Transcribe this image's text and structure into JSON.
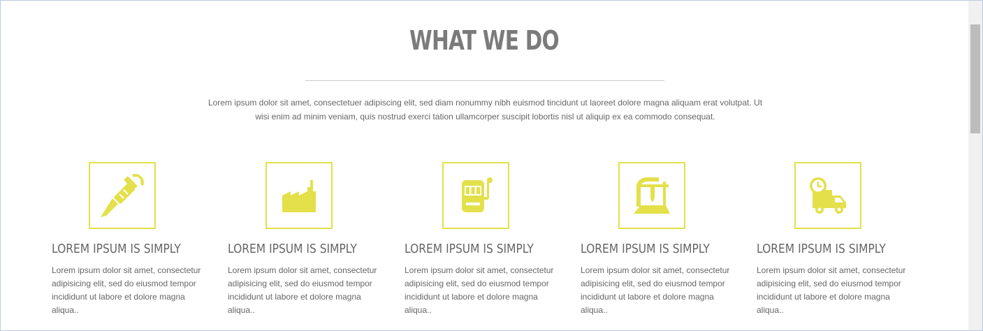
{
  "section": {
    "title": "WHAT WE DO",
    "intro": "Lorem ipsum dolor sit amet, consectetuer adipiscing elit, sed diam nonummy nibh euismod tincidunt ut laoreet dolore magna aliquam erat volutpat. Ut wisi enim ad minim veniam, quis nostrud exerci tation ullamcorper suscipit lobortis nisl ut aliquip ex ea commodo consequat."
  },
  "colors": {
    "accent": "#e3e04a",
    "title": "#7b7b7b",
    "text": "#666666"
  },
  "services": [
    {
      "icon": "syringe-icon",
      "title": "LOREM IPSUM IS SIMPLY",
      "text": "Lorem ipsum dolor sit amet, consectetur adipisicing elit, sed do eiusmod tempor incididunt ut labore et dolore magna aliqua.."
    },
    {
      "icon": "factory-icon",
      "title": "LOREM IPSUM IS SIMPLY",
      "text": "Lorem ipsum dolor sit amet, consectetur adipisicing elit, sed do eiusmod tempor incididunt ut labore et dolore magna aliqua.."
    },
    {
      "icon": "slot-machine-icon",
      "title": "LOREM IPSUM IS SIMPLY",
      "text": "Lorem ipsum dolor sit amet, consectetur adipisicing elit, sed do eiusmod tempor incididunt ut labore et dolore magna aliqua.."
    },
    {
      "icon": "cnc-machine-icon",
      "title": "LOREM IPSUM IS SIMPLY",
      "text": "Lorem ipsum dolor sit amet, consectetur adipisicing elit, sed do eiusmod tempor incididunt ut labore et dolore magna aliqua.."
    },
    {
      "icon": "delivery-truck-icon",
      "title": "LOREM IPSUM IS SIMPLY",
      "text": "Lorem ipsum dolor sit amet, consectetur adipisicing elit, sed do eiusmod tempor incididunt ut labore et dolore magna aliqua.."
    }
  ]
}
